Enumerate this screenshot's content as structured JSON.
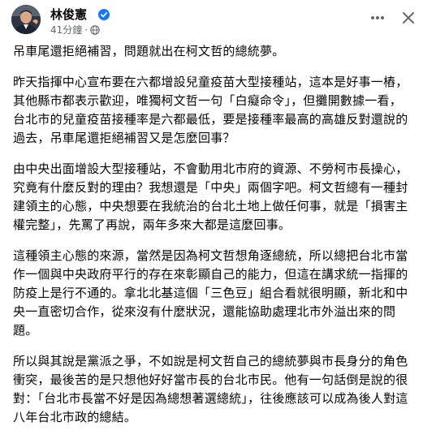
{
  "post": {
    "author": "林俊憲",
    "time": "41分鐘",
    "dot": "·",
    "paragraphs": [
      "吊車尾還拒絕補習，問題就出在柯文哲的總統夢。",
      "昨天指揮中心宣布要在六都增設兒童疫苗大型接種站，這本是好事一樁，其他縣市都表示歡迎，唯獨柯文哲一句「白癡命令」，但攤開數據一看，台北市的兒童疫苗接種率是六都最低，要是接種率最高的高雄反對還說的過去，吊車尾還拒絕補習又是怎麼回事？",
      "由中央出面增設大型接種站，不會動用北市府的資源、不勞柯市長操心，究竟有什麼反對的理由？我想還是「中央」兩個字吧。柯文哲總有一種封建領主的心態，中央想要在我統治的台北土地上做任何事，就是「損害主權完整」，先罵了再說，兩年多來大都是這麼回事。",
      "這種領主心態的來源，當然是因為柯文哲想角逐總統，所以總把台北市當作一個與中央政府平行的存在來彰顯自己的能力，但這在講求統一指揮的防疫上是行不通的。拿北北基這個「三色豆」組合看就很明顯，新北和中央一直密切合作，從來沒有什麼狀況，還能協助處理北市外溢出來的問題。",
      "所以與其說是黨派之爭，不如說是柯文哲自己的總統夢與市長身分的角色衝突，最後苦的是只想他好好當市長的台北市民。他有一句話倒是說的很對：「台北市長當不好是因為總想著選總統」，往後應該可以成為後人對這八年台北市政的總結。"
    ]
  }
}
